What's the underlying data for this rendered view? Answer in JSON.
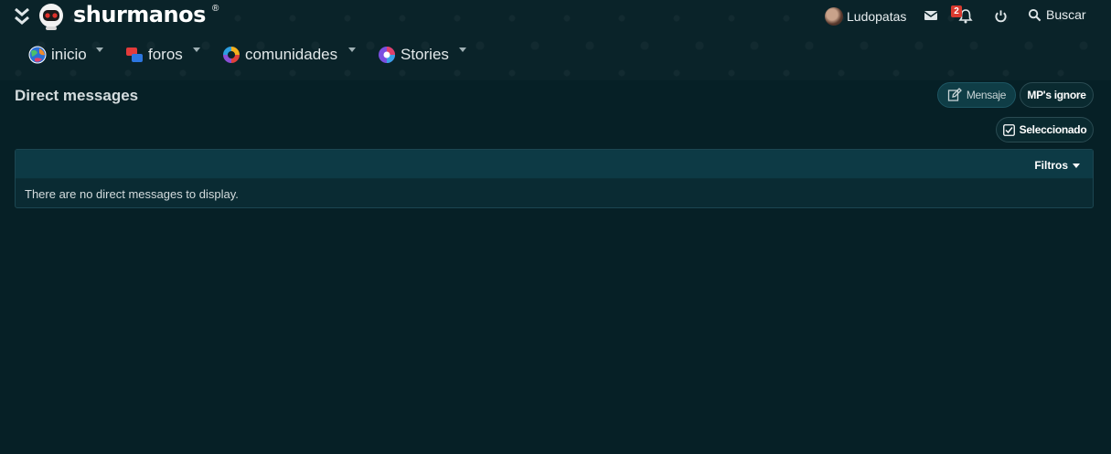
{
  "header": {
    "logo_text": "shurmanos",
    "logo_reg": "®",
    "collapse_icon": "double-chevron-down-icon",
    "logo_icon": "robot-mascot-icon"
  },
  "user": {
    "name": "Ludopatas",
    "notifications_count": "2"
  },
  "topbar": {
    "search_label": "Buscar"
  },
  "nav": {
    "items": [
      {
        "label": "inicio",
        "icon": "globe-icon"
      },
      {
        "label": "foros",
        "icon": "forums-icon"
      },
      {
        "label": "comunidades",
        "icon": "communities-icon"
      },
      {
        "label": "Stories",
        "icon": "stories-icon"
      }
    ]
  },
  "page": {
    "title": "Direct messages",
    "btn_mensaje": "Mensaje",
    "btn_ignore": "MP's ignore",
    "btn_selec": "Seleccionado",
    "filters_label": "Filtros",
    "empty_message": "There are no direct messages to display."
  },
  "colors": {
    "background": "#062026",
    "accent": "#0f3d46",
    "badge": "#d93a2f"
  }
}
